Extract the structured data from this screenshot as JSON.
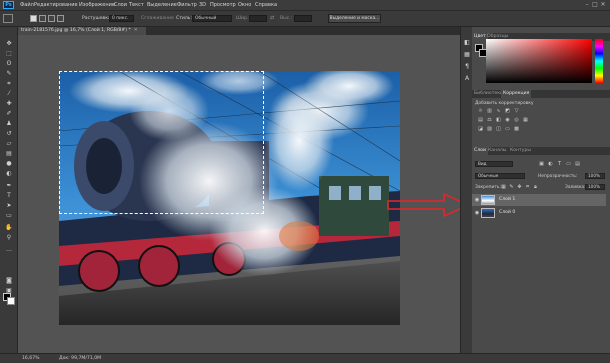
{
  "app": {
    "logo": "Ps"
  },
  "menu": [
    "Файл",
    "Редактирование",
    "Изображение",
    "Слои",
    "Текст",
    "Выделение",
    "Фильтр",
    "3D",
    "Просмотр",
    "Окно",
    "Справка"
  ],
  "window_controls": {
    "minimize": "–",
    "maximize": "□",
    "close": "✕"
  },
  "options": {
    "feather_label": "Растушевка:",
    "feather_value": "0 пикс.",
    "antialias_label": "Сглаживание",
    "style_label": "Стиль:",
    "style_value": "Обычный",
    "width_label": "Шир.:",
    "height_label": "Выс.:",
    "select_mask_button": "Выделение и маска..."
  },
  "document": {
    "tab_title": "train-2181576.jpg @ 16,7% (Слой 1, RGB/8#) *"
  },
  "status": {
    "zoom": "16,67%",
    "doc_size": "Док: 99,7M/71,0M"
  },
  "color_panel": {
    "tabs": [
      "Цвет",
      "Образцы"
    ],
    "fg": "#000000",
    "bg": "#000000"
  },
  "adjust_panel": {
    "tabs": [
      "Библиотеки",
      "Коррекция"
    ],
    "add_label": "Добавить корректировку"
  },
  "layers_panel": {
    "tabs": [
      "Слои",
      "Каналы",
      "Контуры"
    ],
    "filter_kind": "Вид",
    "blend_mode": "Обычные",
    "opacity_label": "Непрозрачность:",
    "opacity_value": "100%",
    "lock_label": "Закрепить:",
    "fill_label": "Заливка:",
    "fill_value": "100%",
    "layers": [
      {
        "name": "Слой 1",
        "visible": true,
        "selected": true
      },
      {
        "name": "Слой 0",
        "visible": true,
        "selected": false
      }
    ]
  },
  "annotation": {
    "arrow_color": "#e8242a"
  }
}
